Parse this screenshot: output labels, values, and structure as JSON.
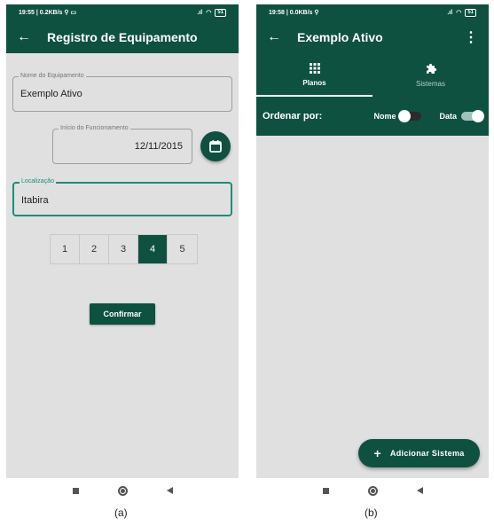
{
  "screen_a": {
    "status": {
      "left": "19:55 | 0.2KB/s ⚲ ▭",
      "battery": "51"
    },
    "app_bar": {
      "back": "←",
      "title": "Registro de Equipamento"
    },
    "name_field": {
      "label": "Nome do Equipamento",
      "value": "Exemplo Ativo"
    },
    "date_field": {
      "label": "Início do Funcionamento",
      "value": "12/11/2015"
    },
    "location_field": {
      "label": "Localização",
      "value": "Itabira"
    },
    "pager": {
      "pages": [
        "1",
        "2",
        "3",
        "4",
        "5"
      ],
      "selected": "4"
    },
    "confirm_label": "Confirmar",
    "caption": "(a)"
  },
  "screen_b": {
    "status": {
      "left": "19:58 | 0.0KB/s ⚲",
      "battery": "51"
    },
    "app_bar": {
      "back": "←",
      "title": "Exemplo Ativo",
      "more": "⋮"
    },
    "tabs": [
      {
        "label": "Planos",
        "icon": "grid-icon",
        "active": true
      },
      {
        "label": "Sistemas",
        "icon": "puzzle-icon",
        "active": false
      }
    ],
    "sort": {
      "label": "Ordenar por:",
      "options": [
        {
          "label": "Nome",
          "on": false
        },
        {
          "label": "Data",
          "on": true
        }
      ]
    },
    "fab": {
      "icon": "+",
      "label": "Adicionar Sistema"
    },
    "caption": "(b)"
  },
  "colors": {
    "primary": "#0e5140",
    "accent": "#17907a",
    "background": "#e0e0e0"
  }
}
